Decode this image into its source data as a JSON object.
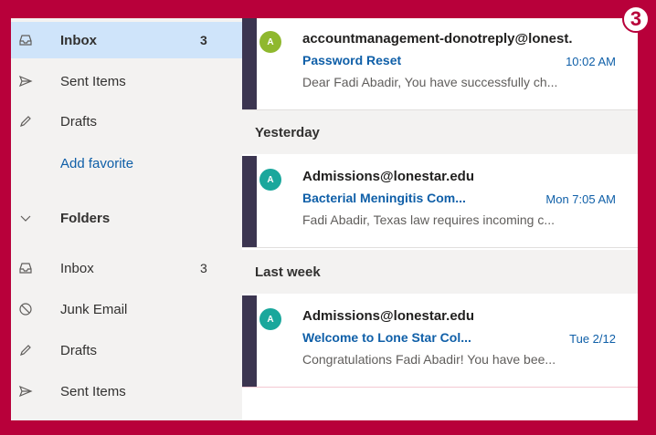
{
  "step_badge": "3",
  "sidebar": {
    "favorites": [
      {
        "label": "Inbox",
        "count": "3",
        "icon": "inbox-icon",
        "selected": true
      },
      {
        "label": "Sent Items",
        "count": "",
        "icon": "send-icon"
      },
      {
        "label": "Drafts",
        "count": "",
        "icon": "pencil-icon"
      }
    ],
    "add_favorite": "Add favorite",
    "folders_header": "Folders",
    "folders": [
      {
        "label": "Inbox",
        "count": "3",
        "icon": "inbox-icon"
      },
      {
        "label": "Junk Email",
        "count": "",
        "icon": "block-icon"
      },
      {
        "label": "Drafts",
        "count": "",
        "icon": "pencil-icon"
      },
      {
        "label": "Sent Items",
        "count": "",
        "icon": "send-icon"
      }
    ]
  },
  "messages": {
    "today": {
      "avatar": "A",
      "avatar_color": "#8fb82e",
      "sender": "accountmanagement-donotreply@lonest.",
      "subject": "Password Reset",
      "time": "10:02 AM",
      "preview": "Dear Fadi Abadir, You have successfully ch..."
    },
    "yesterday_header": "Yesterday",
    "yesterday": {
      "avatar": "A",
      "avatar_color": "#1aa79c",
      "sender": "Admissions@lonestar.edu",
      "subject": "Bacterial Meningitis Com...",
      "time": "Mon 7:05 AM",
      "preview": "Fadi Abadir, Texas law requires incoming c..."
    },
    "last_week_header": "Last week",
    "last_week": {
      "avatar": "A",
      "avatar_color": "#1aa79c",
      "sender": "Admissions@lonestar.edu",
      "subject": "Welcome to Lone Star Col...",
      "time": "Tue 2/12",
      "preview": "Congratulations Fadi Abadir! You have bee..."
    }
  },
  "colors": {
    "frame_border": "#b8003a",
    "accent": "#0f5fa8",
    "selected": "#cfe4fa",
    "unread_bar": "#3b3550"
  }
}
